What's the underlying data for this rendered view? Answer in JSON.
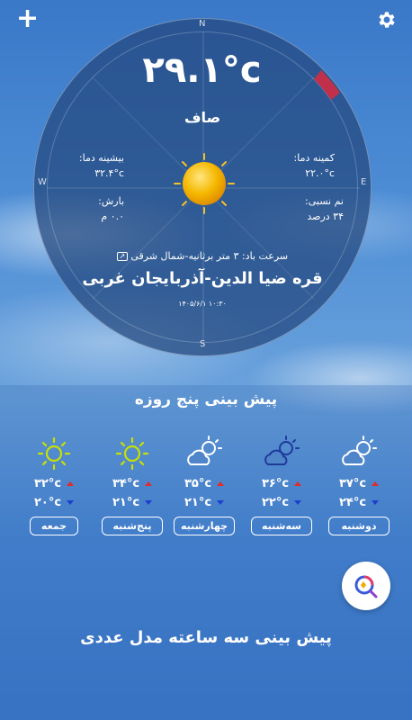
{
  "topbar": {
    "add_icon": "plus-icon",
    "settings_icon": "gear-icon"
  },
  "compass": {
    "n": "N",
    "s": "S",
    "e": "E",
    "w": "W"
  },
  "current": {
    "temperature": "۲۹.۱°c",
    "condition": "صاف",
    "min_label": "کمینه دما:",
    "min_value": "۲۲.۰°c",
    "humidity_label": "نم نسبی:",
    "humidity_value": "۳۴ درصد",
    "max_label": "بیشینه دما:",
    "max_value": "۳۲.۴°c",
    "rain_label": "بارش:",
    "rain_value": "۰.۰ م",
    "wind": "سرعت باد: ۳ متر برثانیه-شمال شرقی",
    "city": "قره ضیا الدین-آذربایجان غربی",
    "datetime": "۱۴۰۵/۶/۱ ۱۰:۳۰",
    "icon": "sun-icon"
  },
  "forecast": {
    "title": "پیش بینی پنج روزه",
    "days": [
      {
        "name": "دوشنبه",
        "max": "۳۷°c",
        "min": "۲۴°c",
        "icon": "partly-cloudy-icon"
      },
      {
        "name": "سه‌شنبه",
        "max": "۳۶°c",
        "min": "۲۲°c",
        "icon": "partly-cloudy-icon"
      },
      {
        "name": "چهارشنبه",
        "max": "۳۵°c",
        "min": "۲۱°c",
        "icon": "partly-cloudy-icon"
      },
      {
        "name": "پنج‌شنبه",
        "max": "۳۴°c",
        "min": "۲۱°c",
        "icon": "sun-icon"
      },
      {
        "name": "جمعه",
        "max": "۳۲°c",
        "min": "۲۰°c",
        "icon": "sun-icon"
      }
    ],
    "numerical_title": "پیش بینی سه ساعته مدل عددی",
    "fab_icon": "assistant-search-icon"
  },
  "colors": {
    "accent_max": "#e02b2b",
    "accent_min": "#1b3fcc",
    "sun": "#f2b400",
    "sun_outline": "#c9e000"
  }
}
